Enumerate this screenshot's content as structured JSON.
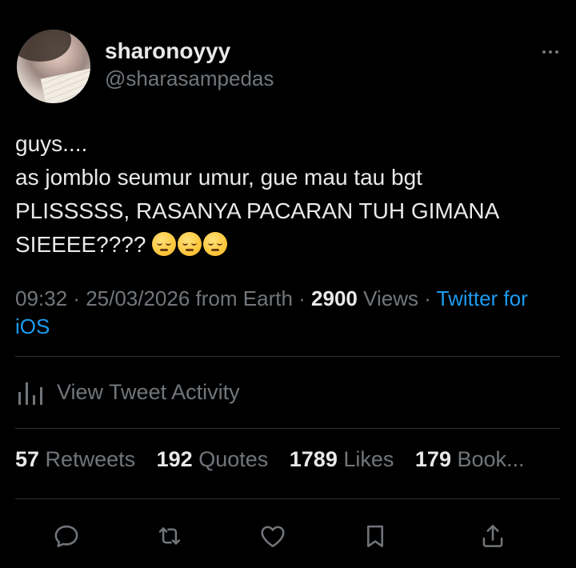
{
  "user": {
    "display_name": "sharonoyyy",
    "handle": "@sharasampedas"
  },
  "tweet": {
    "lines": [
      "guys....",
      "as jomblo seumur umur, gue mau tau bgt",
      "PLISSSSS, RASANYA PACARAN TUH GIMANA",
      "SIEEEE????"
    ],
    "emojis": [
      "pensive-face-emoji",
      "pensive-face-emoji",
      "pensive-face-emoji"
    ]
  },
  "meta": {
    "time": "09:32",
    "sep1": " · ",
    "date": "25/03/2026",
    "location": " from Earth",
    "sep2": " · ",
    "views_count": "2900",
    "views_label": " Views",
    "sep3": " · ",
    "source": "Twitter for iOS"
  },
  "activity": {
    "label": "View Tweet Activity",
    "icon": "analytics-icon"
  },
  "stats": {
    "retweets_count": "57",
    "retweets_label": " Retweets",
    "quotes_count": "192",
    "quotes_label": " Quotes",
    "likes_count": "1789",
    "likes_label": " Likes",
    "bookmarks_count": "179",
    "bookmarks_label": " Book..."
  },
  "actions": [
    "reply-icon",
    "retweet-icon",
    "like-icon",
    "bookmark-icon",
    "share-icon"
  ],
  "colors": {
    "background": "#000000",
    "text_primary": "#e7e9ea",
    "text_secondary": "#71767b",
    "accent": "#1d9bf0",
    "divider": "#2f3336"
  }
}
